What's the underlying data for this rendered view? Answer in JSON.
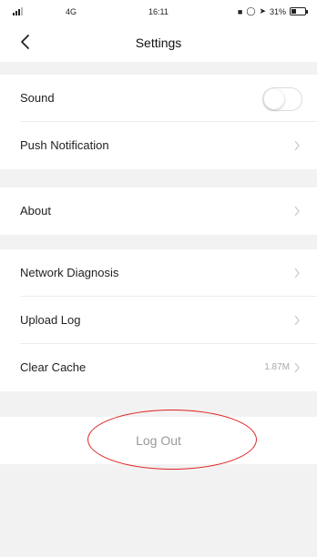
{
  "status_bar": {
    "carrier": "4G",
    "time": "16:11",
    "battery": "31%",
    "battery_level": 0.31
  },
  "nav": {
    "title": "Settings"
  },
  "settings": {
    "sound": {
      "label": "Sound",
      "enabled": false
    },
    "push": {
      "label": "Push Notification"
    },
    "about": {
      "label": "About"
    },
    "network": {
      "label": "Network Diagnosis"
    },
    "upload": {
      "label": "Upload Log"
    },
    "cache": {
      "label": "Clear Cache",
      "value": "1.87M"
    }
  },
  "logout": {
    "label": "Log Out"
  },
  "colors": {
    "background": "#f2f2f2",
    "annotation_ring": "#e02020"
  },
  "icons": [
    "signal-icon",
    "back-arrow-icon",
    "chevron-right-icon",
    "battery-icon"
  ]
}
